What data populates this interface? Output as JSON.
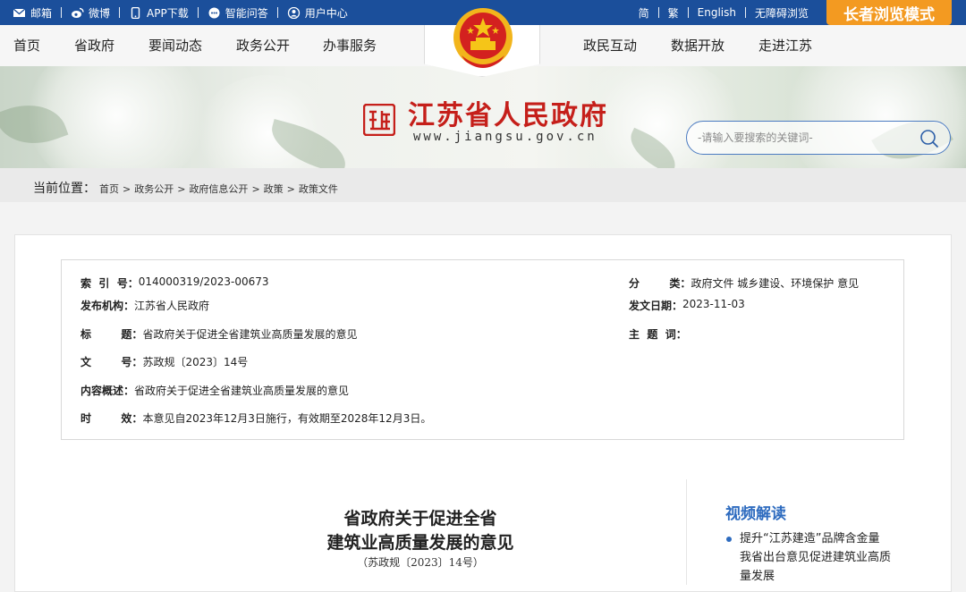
{
  "topbar": {
    "links": [
      {
        "icon": "mail-icon",
        "label": "邮箱"
      },
      {
        "icon": "weibo-icon",
        "label": "微博"
      },
      {
        "icon": "phone-icon",
        "label": "APP下载"
      },
      {
        "icon": "chat-icon",
        "label": "智能问答"
      },
      {
        "icon": "user-icon",
        "label": "用户中心"
      }
    ],
    "lang": [
      "简",
      "繁",
      "English",
      "无障碍浏览"
    ],
    "elder_mode": "长者浏览模式"
  },
  "nav": {
    "left": [
      "首页",
      "省政府",
      "要闻动态",
      "政务公开",
      "办事服务"
    ],
    "right": [
      "政民互动",
      "数据开放",
      "走进江苏"
    ]
  },
  "site": {
    "title": "江苏省人民政府",
    "url": "www.jiangsu.gov.cn"
  },
  "search": {
    "placeholder": "-请输入要搜索的关键词-"
  },
  "breadcrumb": {
    "label": "当前位置：",
    "items": [
      "首页",
      "政务公开",
      "政府信息公开",
      "政策",
      "政策文件"
    ],
    "separator": ">"
  },
  "meta": {
    "index_key": "索  引  号：",
    "index_val": "014000319/2023-00673",
    "category_key": "分        类：",
    "category_val": "政府文件 城乡建设、环境保护 意见",
    "issuer_key": "发布机构：",
    "issuer_val": "江苏省人民政府",
    "date_key": "发文日期：",
    "date_val": "2023-11-03",
    "title_key": "标        题：",
    "title_val": "省政府关于促进全省建筑业高质量发展的意见",
    "keywords_key": "主  题  词：",
    "keywords_val": "",
    "docno_key": "文        号：",
    "docno_val": "苏政规〔2023〕14号",
    "summary_key": "内容概述：",
    "summary_val": "省政府关于促进全省建筑业高质量发展的意见",
    "validity_key": "时        效：",
    "validity_val": "本意见自2023年12月3日施行，有效期至2028年12月3日。"
  },
  "document": {
    "title_line1": "省政府关于促进全省",
    "title_line2": "建筑业高质量发展的意见",
    "doc_no": "（苏政规〔2023〕14号）"
  },
  "sidebar": {
    "video_title": "视频解读",
    "video_items": [
      "提升“江苏建造”品牌含金量　我省出台意见促进建筑业高质量发展"
    ]
  }
}
